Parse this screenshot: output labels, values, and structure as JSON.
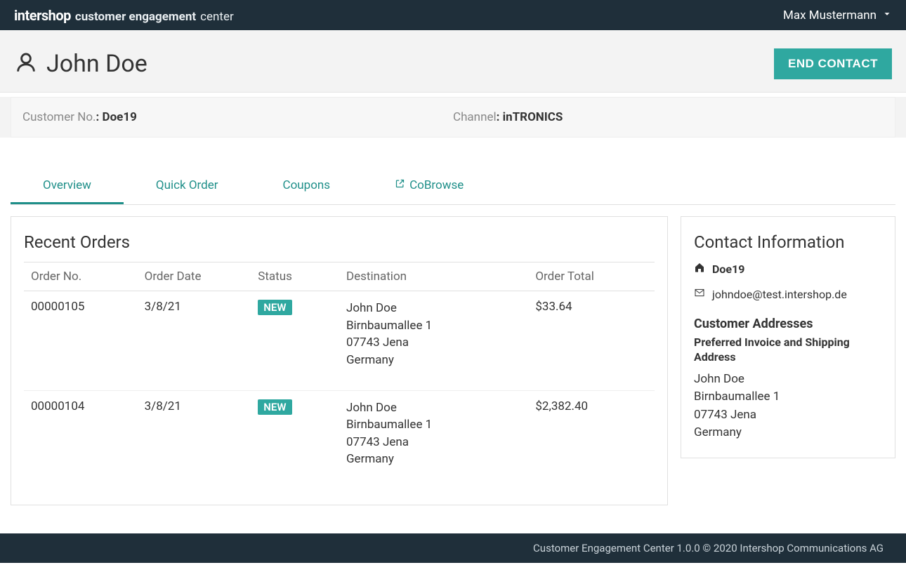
{
  "brand": {
    "logo": "intershop",
    "sub1": "customer engagement",
    "sub2": "center"
  },
  "user": {
    "name": "Max Mustermann"
  },
  "header": {
    "customer_name": "John Doe",
    "end_contact_label": "END CONTACT"
  },
  "info": {
    "customer_no_label": "Customer No.",
    "customer_no_value": "Doe19",
    "channel_label": "Channel",
    "channel_value": "inTRONICS"
  },
  "tabs": {
    "overview": "Overview",
    "quick_order": "Quick Order",
    "coupons": "Coupons",
    "cobrowse": "CoBrowse"
  },
  "orders_panel": {
    "title": "Recent Orders",
    "cols": {
      "order_no": "Order No.",
      "order_date": "Order Date",
      "status": "Status",
      "destination": "Destination",
      "order_total": "Order Total"
    },
    "rows": [
      {
        "order_no": "00000105",
        "order_date": "3/8/21",
        "status": "NEW",
        "dest_name": "John Doe",
        "dest_street": "Birnbaumallee 1",
        "dest_city": "07743 Jena",
        "dest_country": "Germany",
        "total": "$33.64"
      },
      {
        "order_no": "00000104",
        "order_date": "3/8/21",
        "status": "NEW",
        "dest_name": "John Doe",
        "dest_street": "Birnbaumallee 1",
        "dest_city": "07743 Jena",
        "dest_country": "Germany",
        "total": "$2,382.40"
      }
    ]
  },
  "contact_panel": {
    "title": "Contact Information",
    "id": "Doe19",
    "email": "johndoe@test.intershop.de",
    "addresses_heading": "Customer Addresses",
    "preferred_label": "Preferred Invoice and Shipping Address",
    "addr_name": "John Doe",
    "addr_street": "Birnbaumallee 1",
    "addr_city": "07743 Jena",
    "addr_country": "Germany"
  },
  "footer": {
    "text": "Customer Engagement Center 1.0.0 © 2020 Intershop Communications AG"
  }
}
